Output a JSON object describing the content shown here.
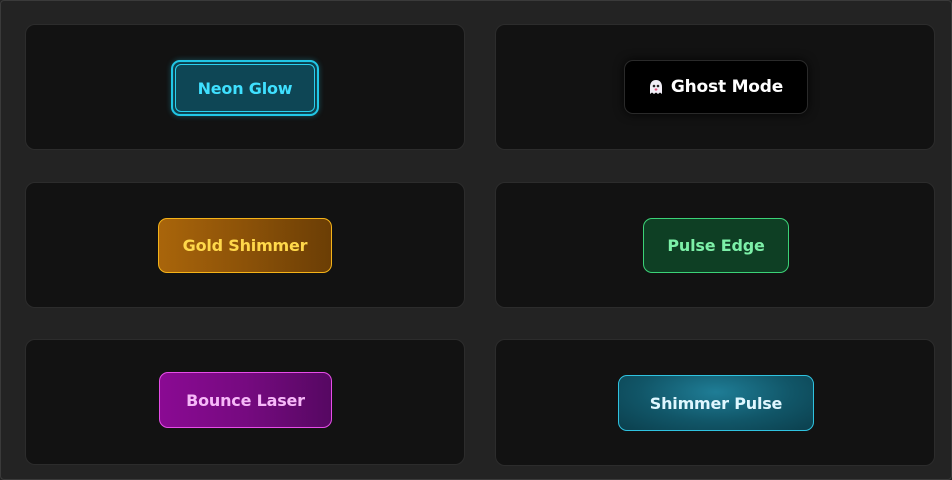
{
  "buttons": {
    "neon_glow": "Neon Glow",
    "ghost_mode": "Ghost Mode",
    "gold_shimmer": "Gold Shimmer",
    "pulse_edge": "Pulse Edge",
    "bounce_laser": "Bounce Laser",
    "shimmer_pulse": "Shimmer Pulse"
  },
  "icons": {
    "ghost_mode": "ghost-icon"
  },
  "colors": {
    "neon_glow": "#3fe0ff",
    "gold_shimmer": "#ffd84a",
    "pulse_edge": "#7cf0a8",
    "bounce_laser": "#f6b9f8",
    "shimmer_pulse": "#2fc3e0"
  }
}
